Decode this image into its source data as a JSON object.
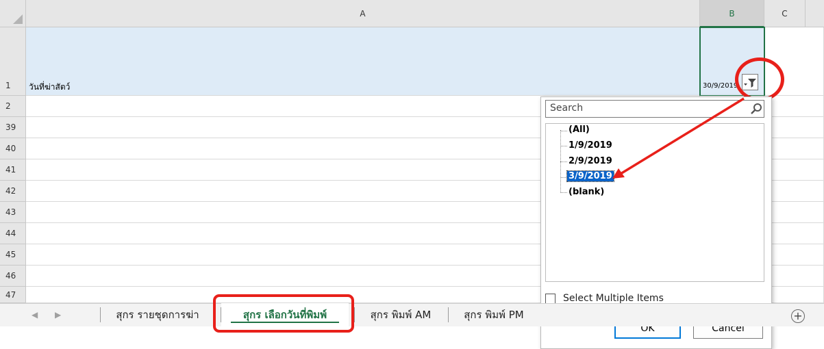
{
  "columns": [
    {
      "label": "A"
    },
    {
      "label": "B"
    },
    {
      "label": "C"
    }
  ],
  "rows": [
    "1",
    "2",
    "39",
    "40",
    "41",
    "42",
    "43",
    "44",
    "45",
    "46",
    "47"
  ],
  "cells": {
    "a1": "วันที่ฆ่าสัตว์",
    "b1": "30/9/2019"
  },
  "filter_menu": {
    "search_placeholder": "Search",
    "items": [
      "(All)",
      "1/9/2019",
      "2/9/2019",
      "3/9/2019",
      "(blank)"
    ],
    "selected_item": "3/9/2019",
    "select_multiple_label": "Select Multiple Items",
    "select_multiple_checked": false,
    "ok_label": "OK",
    "cancel_label": "Cancel"
  },
  "sheet_tabs": [
    {
      "label": "สุกร รายชุดการฆ่า",
      "active": false
    },
    {
      "label": "สุกร เลือกวันที่พิมพ์",
      "active": true
    },
    {
      "label": "สุกร พิมพ์ AM",
      "active": false
    },
    {
      "label": "สุกร พิมพ์ PM",
      "active": false
    }
  ],
  "nav": {
    "prev": "◀",
    "next": "▶",
    "add": "+"
  },
  "colors": {
    "accent": "#217346",
    "annotation_red": "#e8201a",
    "highlight": "#0a63c9"
  }
}
